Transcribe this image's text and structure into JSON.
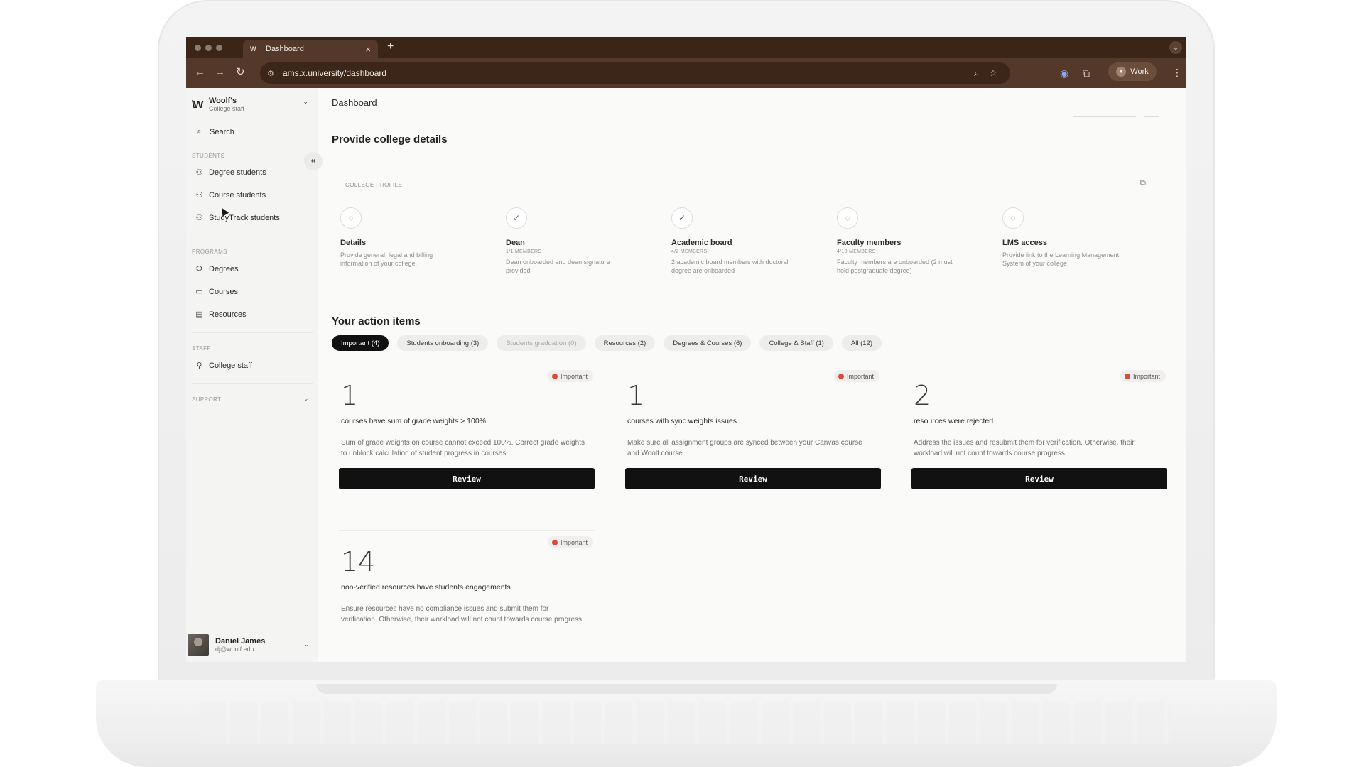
{
  "browser": {
    "tab_title": "Dashboard",
    "tab_favicon": "W",
    "url": "ams.x.university/dashboard",
    "profile_label": "Work"
  },
  "sidebar": {
    "brand_name": "Woolf's",
    "brand_sub": "College staff",
    "brand_logo": "\\W",
    "search_label": "Search",
    "sections": {
      "students": "STUDENTS",
      "programs": "PROGRAMS",
      "staff": "STAFF",
      "support": "SUPPORT"
    },
    "items": {
      "degree_students": "Degree students",
      "course_students": "Course students",
      "studytrack_students": "StudyTrack students",
      "degrees": "Degrees",
      "courses": "Courses",
      "resources": "Resources",
      "college_staff": "College staff"
    },
    "user": {
      "name": "Daniel James",
      "email": "dj@woolf.edu"
    }
  },
  "main": {
    "page_title": "Dashboard",
    "profile_heading": "Provide college details",
    "profile_label": "COLLEGE PROFILE",
    "steps": [
      {
        "title": "Details",
        "meta": "",
        "desc": "Provide general, legal and billing information of your college.",
        "status": "pending"
      },
      {
        "title": "Dean",
        "meta": "1/1 MEMBERS",
        "desc": "Dean onboarded and dean signature provided",
        "status": "done"
      },
      {
        "title": "Academic board",
        "meta": "4/2 MEMBERS",
        "desc": "2 academic board members with doctoral degree are onboarded",
        "status": "done"
      },
      {
        "title": "Faculty members",
        "meta": "4/10 MEMBERS",
        "desc": "Faculty members are onboarded (2 must hold postgraduate degree)",
        "status": "pending"
      },
      {
        "title": "LMS access",
        "meta": "",
        "desc": "Provide link to the Learning Management System of your college.",
        "status": "pending"
      }
    ],
    "actions_heading": "Your action items",
    "filters": [
      {
        "label": "Important (4)",
        "state": "active"
      },
      {
        "label": "Students onboarding (3)",
        "state": "normal"
      },
      {
        "label": "Students graduation (0)",
        "state": "muted"
      },
      {
        "label": "Resources (2)",
        "state": "normal"
      },
      {
        "label": "Degrees & Courses (6)",
        "state": "normal"
      },
      {
        "label": "College & Staff (1)",
        "state": "normal"
      },
      {
        "label": "All (12)",
        "state": "normal"
      }
    ],
    "cards": [
      {
        "badge": "Important",
        "number": "1",
        "subtitle": "courses have sum of grade weights > 100%",
        "desc": "Sum of grade weights on course cannot exceed 100%. Correct grade weights to unblock calculation of student progress in courses.",
        "button": "Review"
      },
      {
        "badge": "Important",
        "number": "1",
        "subtitle": "courses with sync weights issues",
        "desc": "Make sure all assignment groups are synced between your Canvas course and Woolf course.",
        "button": "Review"
      },
      {
        "badge": "Important",
        "number": "2",
        "subtitle": "resources were rejected",
        "desc": "Address the issues and resubmit them for verification. Otherwise, their workload will not count towards course progress.",
        "button": "Review"
      },
      {
        "badge": "Important",
        "number": "14",
        "subtitle": "non-verified resources have students engagements",
        "desc": "Ensure resources have no compliance issues and submit them for verification. Otherwise, their workload will not count towards course progress.",
        "button": ""
      }
    ]
  },
  "colors": {
    "browser_dark": "#3a2516",
    "browser_toolbar": "#54392a",
    "important_dot": "#d94c3d",
    "pending_ring": "#e47b62",
    "button_bg": "#111111"
  }
}
